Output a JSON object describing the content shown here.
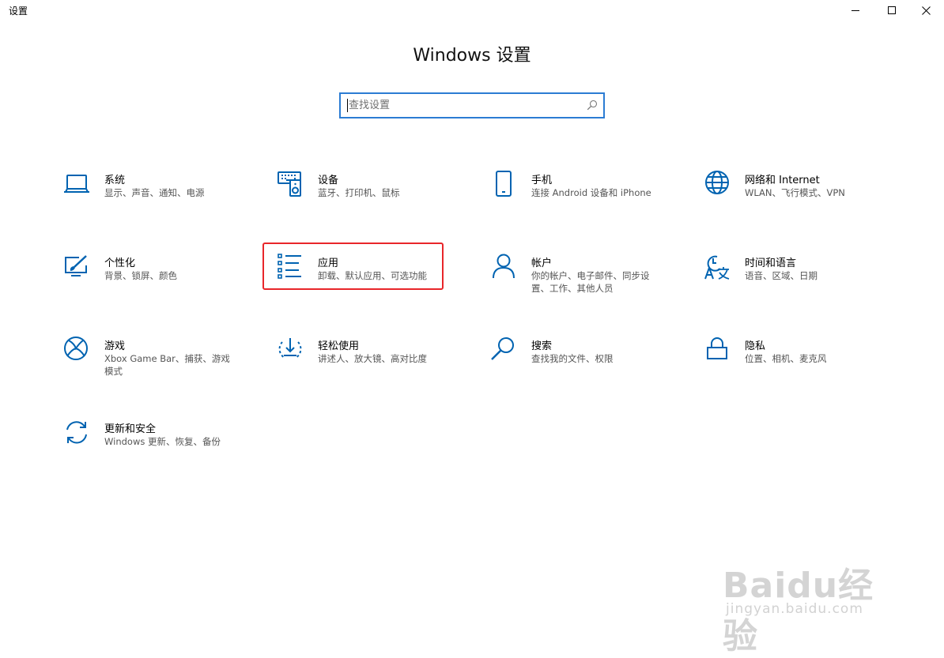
{
  "window": {
    "title": "设置",
    "controls": [
      "minimize-icon",
      "maximize-icon",
      "close-icon"
    ]
  },
  "page_title": "Windows 设置",
  "search": {
    "placeholder": "查找设置",
    "value": "",
    "icon": "search-icon"
  },
  "accent_color": "#0063b1",
  "highlight_color": "#e8262a",
  "tiles": [
    {
      "label": "系统",
      "desc": "显示、声音、通知、电源",
      "icon": "laptop-icon"
    },
    {
      "label": "设备",
      "desc": "蓝牙、打印机、鼠标",
      "icon": "keyboard-speaker-icon"
    },
    {
      "label": "手机",
      "desc": "连接 Android 设备和 iPhone",
      "icon": "phone-icon"
    },
    {
      "label": "网络和 Internet",
      "desc": "WLAN、飞行模式、VPN",
      "icon": "globe-icon"
    },
    {
      "label": "个性化",
      "desc": "背景、锁屏、颜色",
      "icon": "paint-monitor-icon"
    },
    {
      "label": "应用",
      "desc": "卸载、默认应用、可选功能",
      "icon": "app-list-icon",
      "highlighted": true
    },
    {
      "label": "帐户",
      "desc": "你的帐户、电子邮件、同步设置、工作、其他人员",
      "icon": "person-icon"
    },
    {
      "label": "时间和语言",
      "desc": "语音、区域、日期",
      "icon": "time-language-icon"
    },
    {
      "label": "游戏",
      "desc": "Xbox Game Bar、捕获、游戏模式",
      "icon": "xbox-icon"
    },
    {
      "label": "轻松使用",
      "desc": "讲述人、放大镜、高对比度",
      "icon": "ease-of-access-icon"
    },
    {
      "label": "搜索",
      "desc": "查找我的文件、权限",
      "icon": "magnifier-icon"
    },
    {
      "label": "隐私",
      "desc": "位置、相机、麦克风",
      "icon": "lock-icon"
    },
    {
      "label": "更新和安全",
      "desc": "Windows 更新、恢复、备份",
      "icon": "sync-icon"
    }
  ],
  "watermark": {
    "logo": "Baidu经验",
    "url": "jingyan.baidu.com"
  }
}
